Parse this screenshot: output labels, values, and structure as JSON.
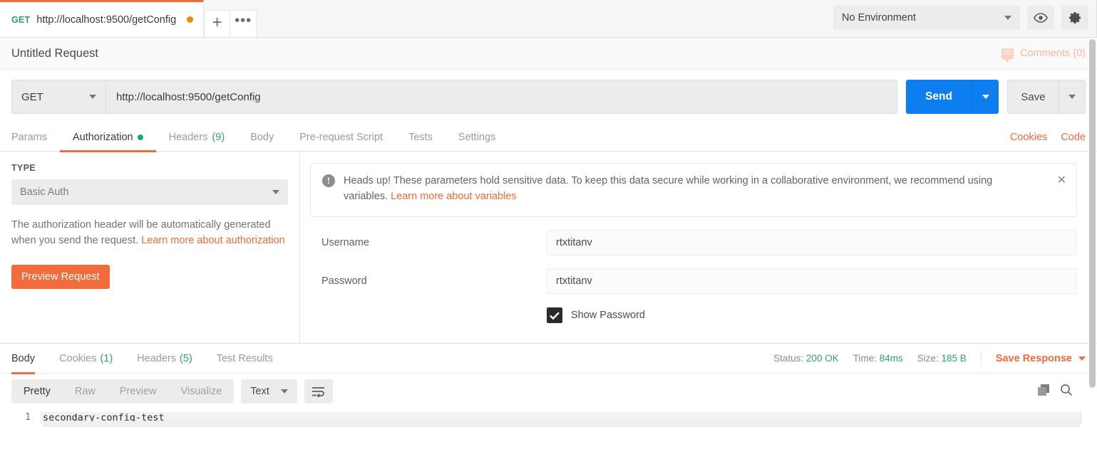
{
  "tabbar": {
    "request_tab": {
      "method": "GET",
      "url": "http://localhost:9500/getConfig",
      "unsaved": true
    },
    "new_tab_label": "+",
    "more_label": "•••",
    "environment": {
      "selected": "No Environment"
    },
    "eye_icon": "eye-icon",
    "settings_icon": "gear-icon"
  },
  "title_row": {
    "request_name": "Untitled Request",
    "comments_label": "Comments (0)"
  },
  "urlbar": {
    "method": "GET",
    "url": "http://localhost:9500/getConfig",
    "send_label": "Send",
    "save_label": "Save"
  },
  "request_tabs": {
    "items": [
      {
        "label": "Params",
        "count": "",
        "dot": false,
        "active": false
      },
      {
        "label": "Authorization",
        "count": "",
        "dot": true,
        "active": true
      },
      {
        "label": "Headers",
        "count": "(9)",
        "dot": false,
        "active": false
      },
      {
        "label": "Body",
        "count": "",
        "dot": false,
        "active": false
      },
      {
        "label": "Pre-request Script",
        "count": "",
        "dot": false,
        "active": false
      },
      {
        "label": "Tests",
        "count": "",
        "dot": false,
        "active": false
      },
      {
        "label": "Settings",
        "count": "",
        "dot": false,
        "active": false
      }
    ],
    "cookies_label": "Cookies",
    "code_label": "Code"
  },
  "auth": {
    "type_label": "TYPE",
    "type_value": "Basic Auth",
    "description_text": "The authorization header will be automatically generated when you send the request. ",
    "description_link": "Learn more about authorization",
    "preview_button": "Preview Request",
    "notice": {
      "text": "Heads up! These parameters hold sensitive data. To keep this data secure while working in a collaborative environment, we recommend using variables. ",
      "link": "Learn more about variables",
      "close_label": "✕",
      "icon": "exclamation-icon"
    },
    "username_label": "Username",
    "username_value": "rtxtitanv",
    "password_label": "Password",
    "password_value": "rtxtitanv",
    "show_password_label": "Show Password",
    "show_password_checked": true
  },
  "response": {
    "tabs": [
      {
        "label": "Body",
        "count": "",
        "active": true
      },
      {
        "label": "Cookies",
        "count": "(1)",
        "active": false
      },
      {
        "label": "Headers",
        "count": "(5)",
        "active": false
      },
      {
        "label": "Test Results",
        "count": "",
        "active": false
      }
    ],
    "status_label": "Status:",
    "status_value": "200 OK",
    "time_label": "Time:",
    "time_value": "84ms",
    "size_label": "Size:",
    "size_value": "185 B",
    "save_response_label": "Save Response",
    "view_modes": [
      {
        "label": "Pretty",
        "active": true
      },
      {
        "label": "Raw",
        "active": false
      },
      {
        "label": "Preview",
        "active": false
      },
      {
        "label": "Visualize",
        "active": false
      }
    ],
    "format": "Text",
    "wrap_icon": "word-wrap-icon",
    "copy_icon": "copy-icon",
    "search_icon": "search-icon",
    "body_lines": [
      {
        "number": "1",
        "text": "secondary-config-test"
      }
    ]
  },
  "colors": {
    "accent_orange": "#f26b3a",
    "send_blue": "#0d7eef",
    "success_green": "#2fa26c",
    "dot_green": "#0cb05e"
  }
}
